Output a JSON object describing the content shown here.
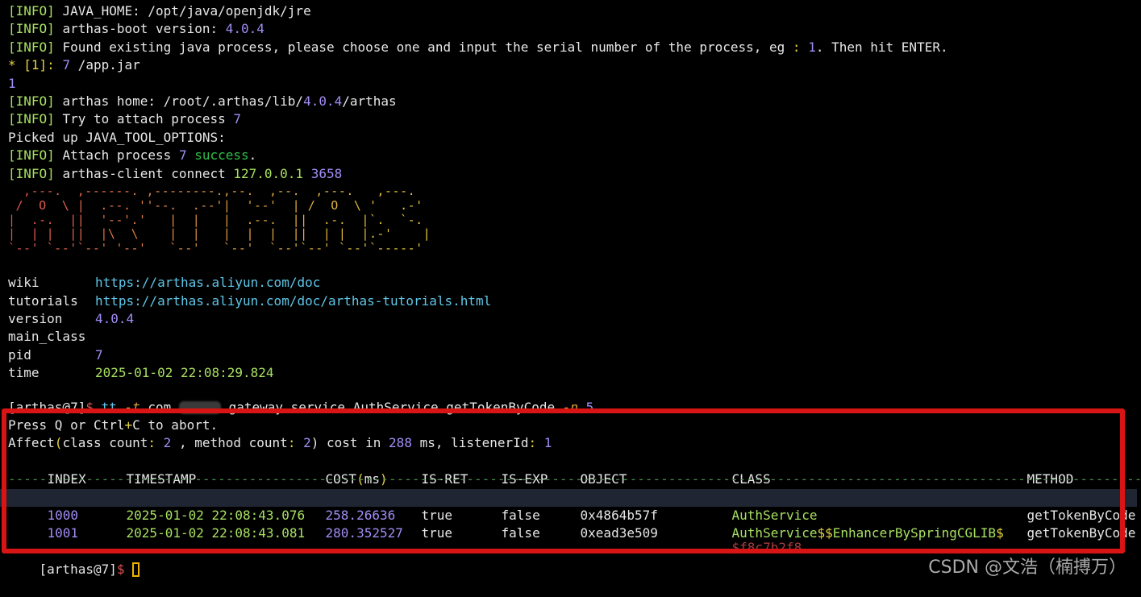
{
  "log": {
    "tag": "[INFO]",
    "java_home_label": "JAVA_HOME: ",
    "java_home_value": "/opt/java/openjdk/jre",
    "boot_label": "arthas-boot version: ",
    "boot_version": "4.0.4",
    "found_text_a": "Found existing java process, please choose one and input the serial number of the process, eg ",
    "found_colon": ": ",
    "found_num": "1",
    "found_text_b": ". Then hit ENTER.",
    "process_star": "* [1]: ",
    "process_pid": "7",
    "process_jar": " /app.jar",
    "user_input": "1",
    "home_label": "arthas home: /root/.arthas/lib/",
    "home_version": "4.0.4",
    "home_suffix": "/arthas",
    "attach_try": "Try to attach process ",
    "attach_pid": "7",
    "picked_up": "Picked up JAVA_TOOL_OPTIONS:",
    "attach_label": "Attach process ",
    "attach_pid2": "7",
    "attach_success": "success",
    "attach_dot": ".",
    "client_label": "arthas-client connect ",
    "client_ip": "127.0.0.1",
    "client_port": "3658"
  },
  "banner": {
    "lines": [
      "  ,---.  ,------. ,--------.,--.  ,--.  ,---.   ,---.",
      " /  O  \\ |  .--. ''--.  .--'|  '--'  | /  O  \\ '   .-'",
      "|  .-.  ||  '--'.'   |  |   |  .--.  ||  .-.  |`.  `-.",
      "|  | |  ||  |\\  \\    |  |   |  |  |  ||  | |  |.-'    |",
      "`--' `--'`--' '--'   `--'   `--'  `--'`--' `--'`-----'"
    ]
  },
  "info": {
    "wiki_key": "wiki",
    "wiki_val": "https://arthas.aliyun.com/doc",
    "tutorials_key": "tutorials",
    "tutorials_val": "https://arthas.aliyun.com/doc/arthas-tutorials.html",
    "version_key": "version",
    "version_val": "4.0.4",
    "main_class_key": "main_class",
    "pid_key": "pid",
    "pid_val": "7",
    "time_key": "time",
    "time_val": "2025-01-02 22:08:29.824"
  },
  "command": {
    "prompt": "[arthas@7]",
    "prompt_sign": "$",
    "cmd": " tt ",
    "flag_t": "-t",
    "pkg_prefix": " com.",
    "pkg_suffix": ".gateway.service.AuthService getTokenByCode ",
    "flag_n": "-n",
    "n_value": " 5",
    "abort_a": "Press Q or Ctrl",
    "abort_plus": "+",
    "abort_b": "C to abort.",
    "affect_a": "Affect",
    "affect_paren": "(",
    "affect_b": "class count",
    "affect_c": ": ",
    "affect_class_count": "2",
    "affect_d": " , method count",
    "affect_e": ": ",
    "affect_method_count": "2",
    "affect_f": ") cost in ",
    "affect_cost": "288",
    "affect_g": " ms, listenerId",
    "affect_h": ": ",
    "affect_listener": "1"
  },
  "table": {
    "headers": {
      "index": "INDEX",
      "timestamp": "TIMESTAMP",
      "cost_a": "COST",
      "cost_b": "(",
      "cost_c": "ms",
      "cost_d": ")",
      "is_ret": "IS-RET",
      "is_exp": "IS-EXP",
      "object": "OBJECT",
      "class": "CLASS",
      "method": "METHOD"
    },
    "divider": "------------------------------------------------------------------------------------------------------------------------------------------------------------------------------------------------------------------------------------------------",
    "rows": [
      {
        "index": "1000",
        "timestamp": "2025-01-02 22:08:43.076",
        "cost": "258.26636",
        "is_ret": "true",
        "is_exp": "false",
        "object": "0x4864b57f",
        "class": "AuthService",
        "method": "getTokenByCode"
      },
      {
        "index": "1001",
        "timestamp": "2025-01-02 22:08:43.081",
        "cost": "280.352527",
        "is_ret": "true",
        "is_exp": "false",
        "object": "0xead3e509",
        "class_a": "AuthService",
        "class_b": "$$",
        "class_c": "EnhancerBySpringCGLIB",
        "class_d": "$",
        "class_e": "$f8c7b2f8",
        "method": "getTokenByCode"
      }
    ]
  },
  "final_prompt": {
    "prompt": "[arthas@7]",
    "sign": "$"
  },
  "watermark": "CSDN @文浩（楠搏万）",
  "colors": {
    "background": "#000000",
    "info_tag": "#a8e060",
    "number": "#a28df5",
    "url": "#5ec6e8",
    "success": "#2fbf45",
    "highlight_box": "#d91414",
    "cursor": "#f0b400"
  }
}
